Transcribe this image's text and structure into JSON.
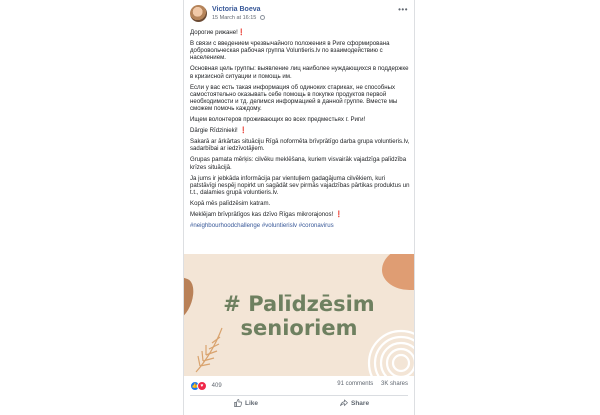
{
  "post": {
    "author": "Victoria Boeva",
    "timestamp": "15 March at 16:15",
    "paragraphs": [
      "Дорогие рижане!",
      "В связи с введением чрезвычайного положения в Риге сформирована добровольческая рабочая группа Voluntieris.lv по взаимодействию с населением.",
      "Основная цель группы: выявление лиц наиболее нуждающихся в поддержке в кризисной ситуации и помощь им.",
      "Если у вас есть такая информация об одиноких стариках, не способных самостоятельно оказывать себе помощь в покупке продуктов первой необходимости и тд. делимся информацией в данной группе. Вместе мы сможем помочь каждому.",
      "Ищем волонтеров проживающих во всех предместьях г. Риги!",
      "Dārgie Rīdzinieki!",
      "Sakarā ar ārkārtas situāciju Rīgā noformēta brīvprātīgo darba grupa voluntieris.lv, sadarbībai ar iedzīvotājiem.",
      "Grupas pamata mērķis: cilvēku meklēšana, kuriem visvairāk vajadzīga palīdzība krīzes situācijā.",
      "Ja jums ir jebkāda informācija par vientuļiem gadagājuma cilvēkiem, kuri patstāvīgi nespēj nopirkt un sagādāt sev pirmās vajadzības pārtikas produktus un t.t., dalamies grupā voluntieris.lv.",
      "Kopā mēs palīdzēsim katram.",
      "Meklējam brīvprātīgos kas dzīvo Rīgas mikrorajonos!"
    ],
    "exclamation_mark": "❗",
    "hashtags": "#neighbourhoodchallenge #voluntierislv #coronavirus",
    "graphic": {
      "line1": "# Palīdzēsim",
      "line2": "senioriem",
      "text_color": "#6e8060",
      "background": "#f3e5d6"
    }
  },
  "stats": {
    "reactions_count": "409",
    "comments": "91 comments",
    "shares": "3K shares"
  },
  "actions": {
    "like_label": "Like",
    "share_label": "Share"
  },
  "icons": [
    "like-reaction-icon",
    "love-reaction-icon",
    "globe-icon",
    "more-options-icon",
    "like-icon",
    "share-icon"
  ],
  "colors": {
    "link": "#385898",
    "accent_orange": "#df9d73",
    "brown": "#b98158"
  }
}
